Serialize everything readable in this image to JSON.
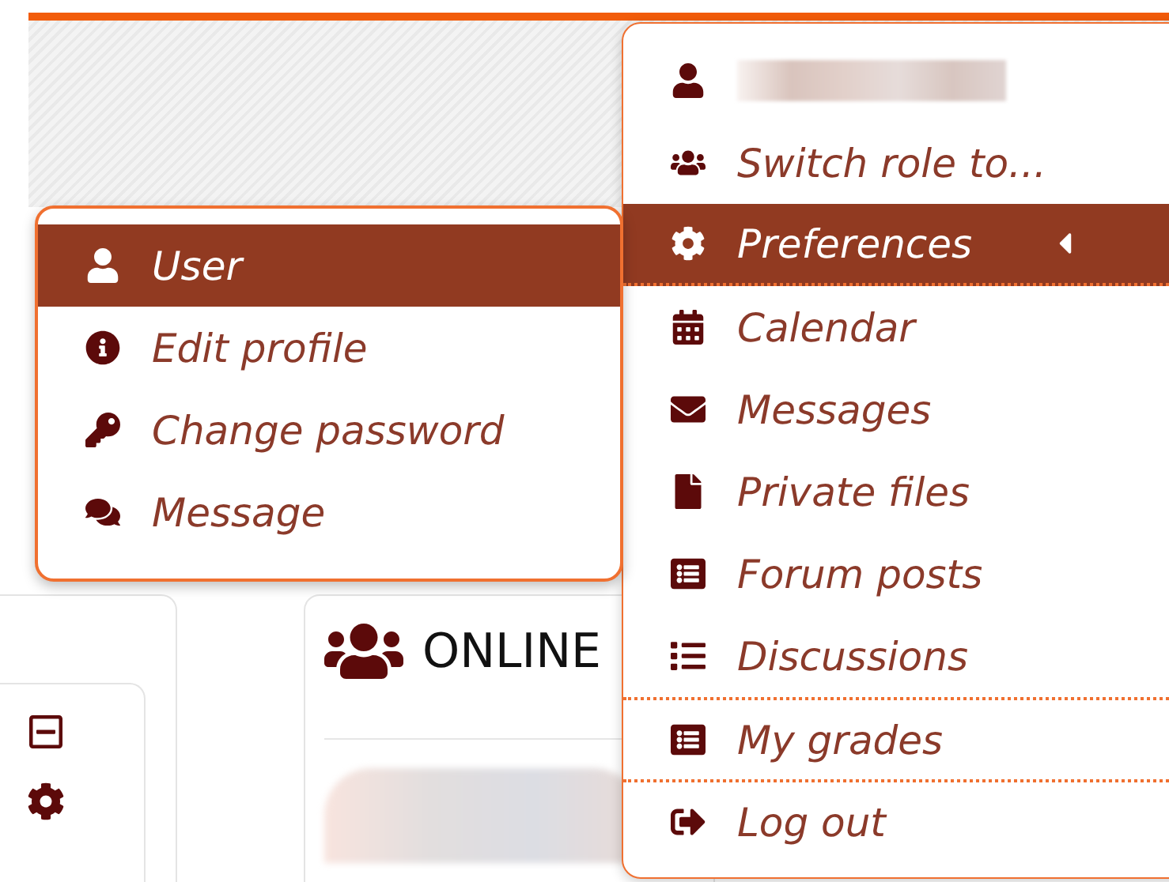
{
  "user_menu": {
    "items": [
      {
        "kind": "profile",
        "selected": false,
        "divider_before": false
      },
      {
        "kind": "link",
        "label": "Switch role to...",
        "selected": false,
        "divider_before": false
      },
      {
        "kind": "submenu",
        "label": "Preferences",
        "selected": true,
        "divider_before": false,
        "expanded": true
      },
      {
        "kind": "link",
        "label": "Calendar",
        "selected": false,
        "divider_before": false
      },
      {
        "kind": "link",
        "label": "Messages",
        "selected": false,
        "divider_before": false
      },
      {
        "kind": "link",
        "label": "Private files",
        "selected": false,
        "divider_before": false
      },
      {
        "kind": "link",
        "label": "Forum posts",
        "selected": false,
        "divider_before": false
      },
      {
        "kind": "link",
        "label": "Discussions",
        "selected": false,
        "divider_before": false
      },
      {
        "kind": "link",
        "label": "My grades",
        "selected": false,
        "divider_before": true
      },
      {
        "kind": "link",
        "label": "Log out",
        "selected": false,
        "divider_before": true
      }
    ]
  },
  "preferences_submenu": {
    "items": [
      {
        "label": "User",
        "selected": true
      },
      {
        "label": "Edit profile",
        "selected": false
      },
      {
        "label": "Change password",
        "selected": false
      },
      {
        "label": "Message",
        "selected": false
      }
    ]
  },
  "online_block": {
    "title": "ONLINE"
  }
}
